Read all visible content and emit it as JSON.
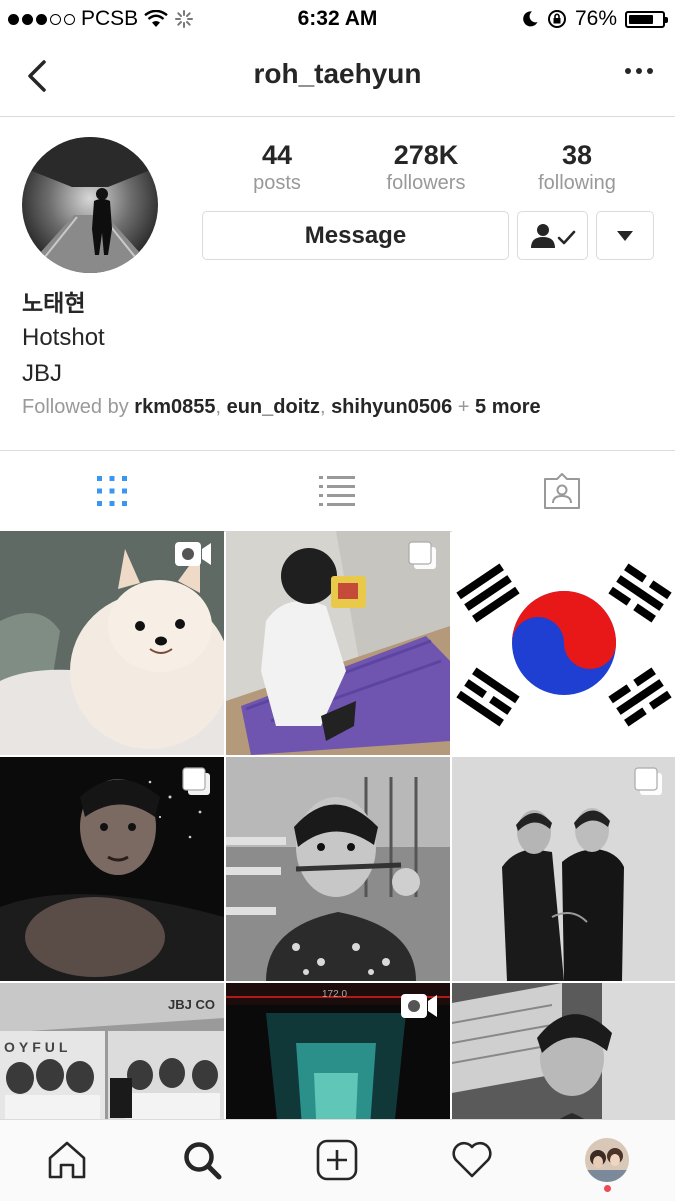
{
  "status_bar": {
    "carrier": "PCSB",
    "time": "6:32 AM",
    "battery": "76%",
    "battery_level": 0.76,
    "signal_bars_filled": 3
  },
  "header": {
    "username": "roh_taehyun",
    "back_icon": "chevron-left-icon",
    "more_icon": "ellipsis-icon"
  },
  "profile": {
    "posts_count": "44",
    "posts_label": "posts",
    "followers_count": "278K",
    "followers_label": "followers",
    "following_count": "38",
    "following_label": "following",
    "message_button": "Message",
    "display_name": "노태현",
    "bio_line_1": "Hotshot",
    "bio_line_2": "JBJ",
    "followed_by_label": "Followed by",
    "followed_by_users": [
      "rkm0855",
      "eun_doitz",
      "shihyun0506"
    ],
    "followed_by_more": "5 more"
  },
  "tabs": {
    "items": [
      {
        "icon": "grid-icon",
        "active": true
      },
      {
        "icon": "list-icon",
        "active": false
      },
      {
        "icon": "tagged-icon",
        "active": false
      }
    ]
  },
  "grid": {
    "posts": [
      {
        "subject": "pomeranian dog",
        "badge": "video-icon"
      },
      {
        "subject": "person sitting on mat",
        "badge": "carousel-icon"
      },
      {
        "subject": "korean flag",
        "badge": null
      },
      {
        "subject": "selfie in water",
        "badge": "carousel-icon"
      },
      {
        "subject": "selfie in cafeteria",
        "badge": null
      },
      {
        "subject": "two people posing",
        "badge": "carousel-icon"
      },
      {
        "subject": "JBJ poster",
        "badge": null
      },
      {
        "subject": "dark corridor video",
        "badge": "video-icon"
      },
      {
        "subject": "portrait in studio",
        "badge": null
      }
    ],
    "poster_text": "JBJ CO",
    "poster_text_2": "OYFUL",
    "video_overlay_text": "172.0"
  },
  "tab_bar": {
    "items": [
      "home-icon",
      "search-icon",
      "add-post-icon",
      "activity-heart-icon",
      "profile-avatar"
    ]
  },
  "colors": {
    "accent": "#3897f0",
    "text": "#262626",
    "secondary": "#999999",
    "border": "#dbdbdb",
    "notification": "#ed4956"
  }
}
